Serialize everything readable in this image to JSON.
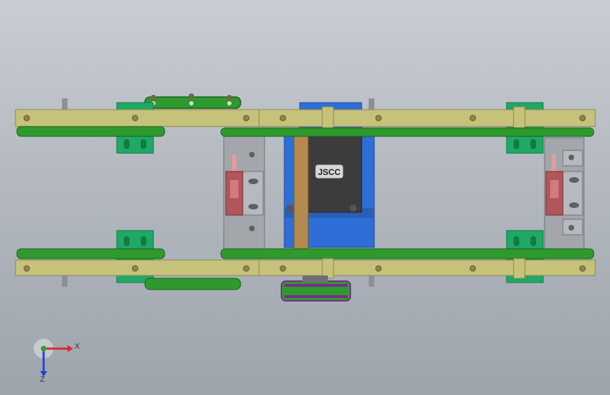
{
  "viewport": {
    "background_top": "#c9cdd3",
    "background_bottom": "#9ea4ac"
  },
  "model": {
    "motor_label": "JSCC",
    "colors": {
      "rail": "#c6c27a",
      "rail_dark": "#8a8650",
      "belt": "#2e9a2e",
      "belt_dark": "#1a5f1a",
      "bracket": "#1fa866",
      "motor_blue": "#2d6fd6",
      "motor_dark": "#3c3c3c",
      "plate": "#a3a6aa",
      "sensor": "#b2565c",
      "pulley": "#7a2b8c",
      "bolt": "#6e6a3a"
    }
  },
  "triad": {
    "x_label": "X",
    "z_label": "Z",
    "x_color": "#d62b2b",
    "y_color": "#27a33a",
    "z_color": "#2b3fd6"
  }
}
